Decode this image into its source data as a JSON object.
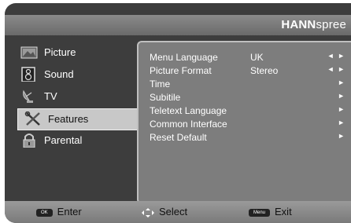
{
  "brand": {
    "bold": "HANN",
    "light": "spree"
  },
  "sidebar": {
    "items": [
      {
        "label": "Picture",
        "icon": "picture-icon"
      },
      {
        "label": "Sound",
        "icon": "speaker-icon"
      },
      {
        "label": "TV",
        "icon": "satellite-dish-icon"
      },
      {
        "label": "Features",
        "icon": "tools-icon",
        "selected": true
      },
      {
        "label": "Parental",
        "icon": "lock-icon"
      }
    ]
  },
  "menu": {
    "rows": [
      {
        "label": "Menu Language",
        "value": "UK",
        "arrows": "◄ ►"
      },
      {
        "label": "Picture Format",
        "value": "Stereo",
        "arrows": "◄ ►"
      },
      {
        "label": "Time",
        "value": "",
        "arrows": "►"
      },
      {
        "label": "Subitile",
        "value": "",
        "arrows": "►"
      },
      {
        "label": "Teletext Language",
        "value": "",
        "arrows": "►"
      },
      {
        "label": "Common Interface",
        "value": "",
        "arrows": "►"
      },
      {
        "label": "Reset Default",
        "value": "",
        "arrows": "►"
      }
    ]
  },
  "footer": {
    "enter_key": "OK",
    "enter_label": "Enter",
    "select_label": "Select",
    "menu_key": "Menu",
    "exit_label": "Exit"
  },
  "colors": {
    "panel": "#7d7d7d",
    "frame": "#3d3d3d",
    "selected": "#c8c8c8"
  }
}
